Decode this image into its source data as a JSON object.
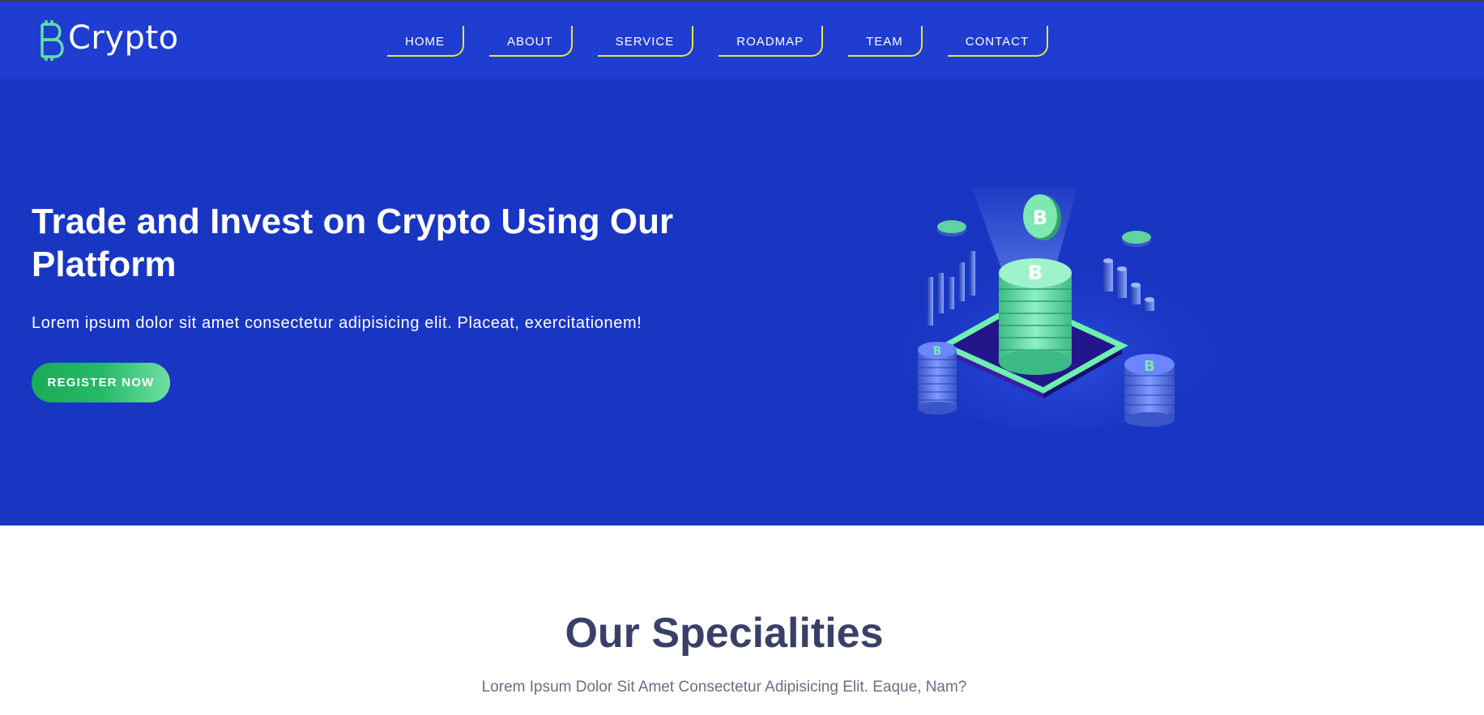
{
  "header": {
    "logo_text": "Crypto",
    "logo_icon": "bitcoin-b-icon",
    "nav": [
      {
        "label": "HOME"
      },
      {
        "label": "ABOUT"
      },
      {
        "label": "SERVICE"
      },
      {
        "label": "ROADMAP"
      },
      {
        "label": "TEAM"
      },
      {
        "label": "CONTACT"
      }
    ]
  },
  "hero": {
    "title": "Trade and Invest on Crypto Using Our Platform",
    "subtitle": "Lorem ipsum dolor sit amet consectetur adipisicing elit. Placeat, exercitationem!",
    "cta_label": "REGISTER NOW",
    "illustration": "crypto-coin-stack-illustration"
  },
  "specialities": {
    "title": "Our Specialities",
    "subtitle": "Lorem Ipsum Dolor Sit Amet Consectetur Adipisicing Elit. Eaque, Nam?"
  },
  "colors": {
    "header_bg": "#1f3dd1",
    "hero_bg": "#1936c3",
    "nav_underline": "#e9e640",
    "accent_green": "#25b967",
    "heading_dark": "#3a3f6a"
  }
}
